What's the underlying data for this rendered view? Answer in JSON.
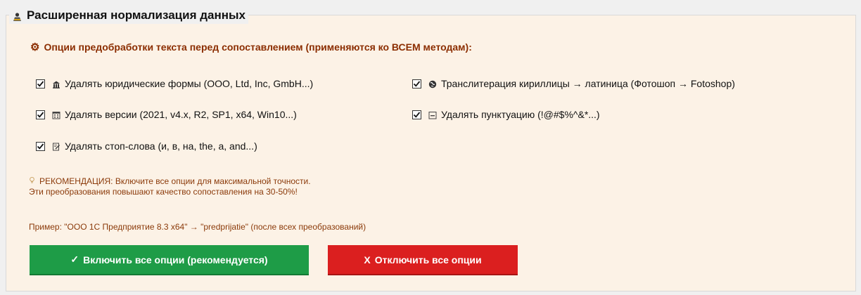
{
  "groupbox": {
    "title": "Расширенная нормализация данных",
    "title_icon": "person-chart-icon"
  },
  "section": {
    "title": "Опции предобработки текста перед сопоставлением (применяются ко ВСЕМ методам):",
    "icon": "gear-icon"
  },
  "options": [
    {
      "label": "Удалять юридические формы (ООО, Ltd, Inc, GmbH...)",
      "checked": true,
      "icon": "building-icon"
    },
    {
      "label": "Транслитерация кириллицы → латиница (Фотошоп → Fotoshop)",
      "checked": true,
      "icon": "globe-icon"
    },
    {
      "label": "Удалять версии (2021, v4.x, R2, SP1, x64, Win10...)",
      "checked": true,
      "icon": "calendar-icon"
    },
    {
      "label": "Удалять пунктуацию (!@#$%^&*...)",
      "checked": true,
      "icon": "minus-box-icon"
    },
    {
      "label": "Удалять стоп-слова (и, в, на, the, a, and...)",
      "checked": true,
      "icon": "edit-note-icon"
    }
  ],
  "recommendation": {
    "line1": "РЕКОМЕНДАЦИЯ: Включите все опции для максимальной точности.",
    "line2": "Эти преобразования повышают качество сопоставления на 30-50%!",
    "icon": "lightbulb-icon"
  },
  "example": "Пример: \"ООО 1С Предприятие 8.3 x64\" → \"predprijatie\" (после всех преобразований)",
  "buttons": {
    "enable_symbol": "✓",
    "enable_label": "Включить все опции (рекомендуется)",
    "disable_symbol": "X",
    "disable_label": "Отключить все опции"
  },
  "colors": {
    "accent_text": "#8b2d00",
    "enable_button": "#1e9c47",
    "disable_button": "#db1f1f",
    "panel_background": "#fcf2e6"
  }
}
